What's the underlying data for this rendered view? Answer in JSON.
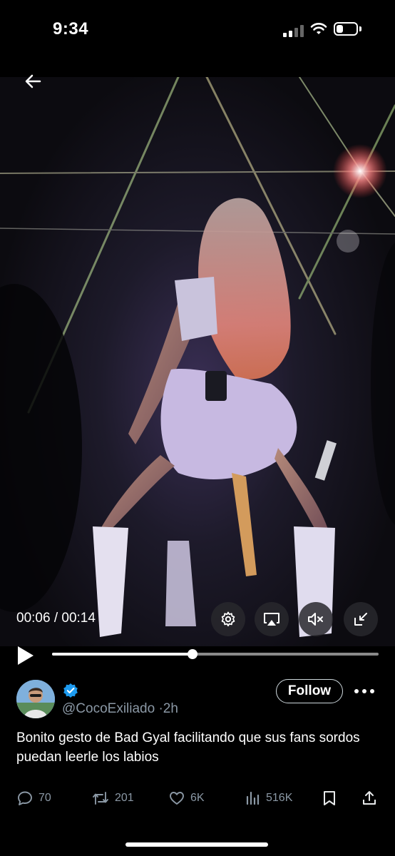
{
  "status_bar": {
    "time": "9:34"
  },
  "video": {
    "current_time": "00:06",
    "duration": "00:14",
    "time_separator": " / ",
    "progress": 0.43
  },
  "tweet": {
    "handle": "@CocoExiliado",
    "separator": "·",
    "age": "2h",
    "follow_label": "Follow",
    "text": "Bonito gesto de Bad Gyal facilitando que sus fans sordos puedan leerle los labios"
  },
  "actions": {
    "replies": "70",
    "reposts": "201",
    "likes": "6K",
    "views": "516K"
  },
  "colors": {
    "background": "#000000",
    "muted_text": "#8b98a5",
    "verified_blue": "#1d9bf0"
  }
}
